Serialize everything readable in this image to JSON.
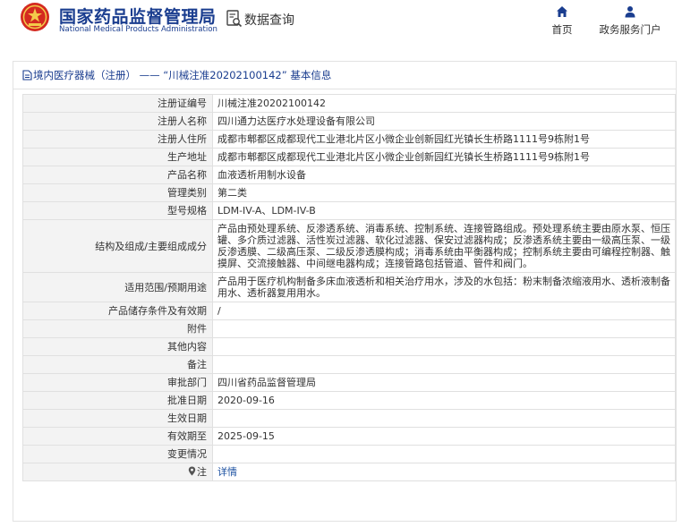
{
  "header": {
    "logo_cn": "国家药品监督管理局",
    "logo_en": "National Medical Products Administration",
    "query_label": "数据查询",
    "nav": [
      {
        "label": "首页",
        "icon": "home-icon"
      },
      {
        "label": "政务服务门户",
        "icon": "user-icon"
      }
    ]
  },
  "breadcrumb": "境内医疗器械（注册） —— “川械注准20202100142” 基本信息",
  "rows": [
    {
      "label": "注册证编号",
      "value": "川械注准20202100142"
    },
    {
      "label": "注册人名称",
      "value": "四川通力达医疗水处理设备有限公司"
    },
    {
      "label": "注册人住所",
      "value": "成都市郫都区成都现代工业港北片区小微企业创新园红光镇长生桥路1111号9栋附1号"
    },
    {
      "label": "生产地址",
      "value": "成都市郫都区成都现代工业港北片区小微企业创新园红光镇长生桥路1111号9栋附1号"
    },
    {
      "label": "产品名称",
      "value": "血液透析用制水设备"
    },
    {
      "label": "管理类别",
      "value": "第二类"
    },
    {
      "label": "型号规格",
      "value": "LDM-IV-A、LDM-IV-B"
    },
    {
      "label": "结构及组成/主要组成成分",
      "value": "产品由预处理系统、反渗透系统、消毒系统、控制系统、连接管路组成。预处理系统主要由原水泵、恒压罐、多介质过滤器、活性炭过滤器、软化过滤器、保安过滤器构成；反渗透系统主要由一级高压泵、一级反渗透膜、二级高压泵、二级反渗透膜构成；消毒系统由平衡器构成；控制系统主要由可编程控制器、触摸屏、交流接触器、中间继电器构成；连接管路包括管道、管件和阀门。"
    },
    {
      "label": "适用范围/预期用途",
      "value": "产品用于医疗机构制备多床血液透析和相关治疗用水，涉及的水包括：粉末制备浓缩液用水、透析液制备用水、透析器复用用水。"
    },
    {
      "label": "产品储存条件及有效期",
      "value": "/"
    },
    {
      "label": "附件",
      "value": ""
    },
    {
      "label": "其他内容",
      "value": ""
    },
    {
      "label": "备注",
      "value": ""
    },
    {
      "label": "审批部门",
      "value": "四川省药品监督管理局"
    },
    {
      "label": "批准日期",
      "value": "2020-09-16"
    },
    {
      "label": "生效日期",
      "value": ""
    },
    {
      "label": "有效期至",
      "value": "2025-09-15"
    },
    {
      "label": "变更情况",
      "value": ""
    }
  ],
  "note": {
    "label": "注",
    "icon": "pin-icon",
    "link": "详情"
  },
  "colors": {
    "brand_blue": "#1a3d8f",
    "logo_red": "#d42a20",
    "label_bg": "#f3f3f3"
  }
}
